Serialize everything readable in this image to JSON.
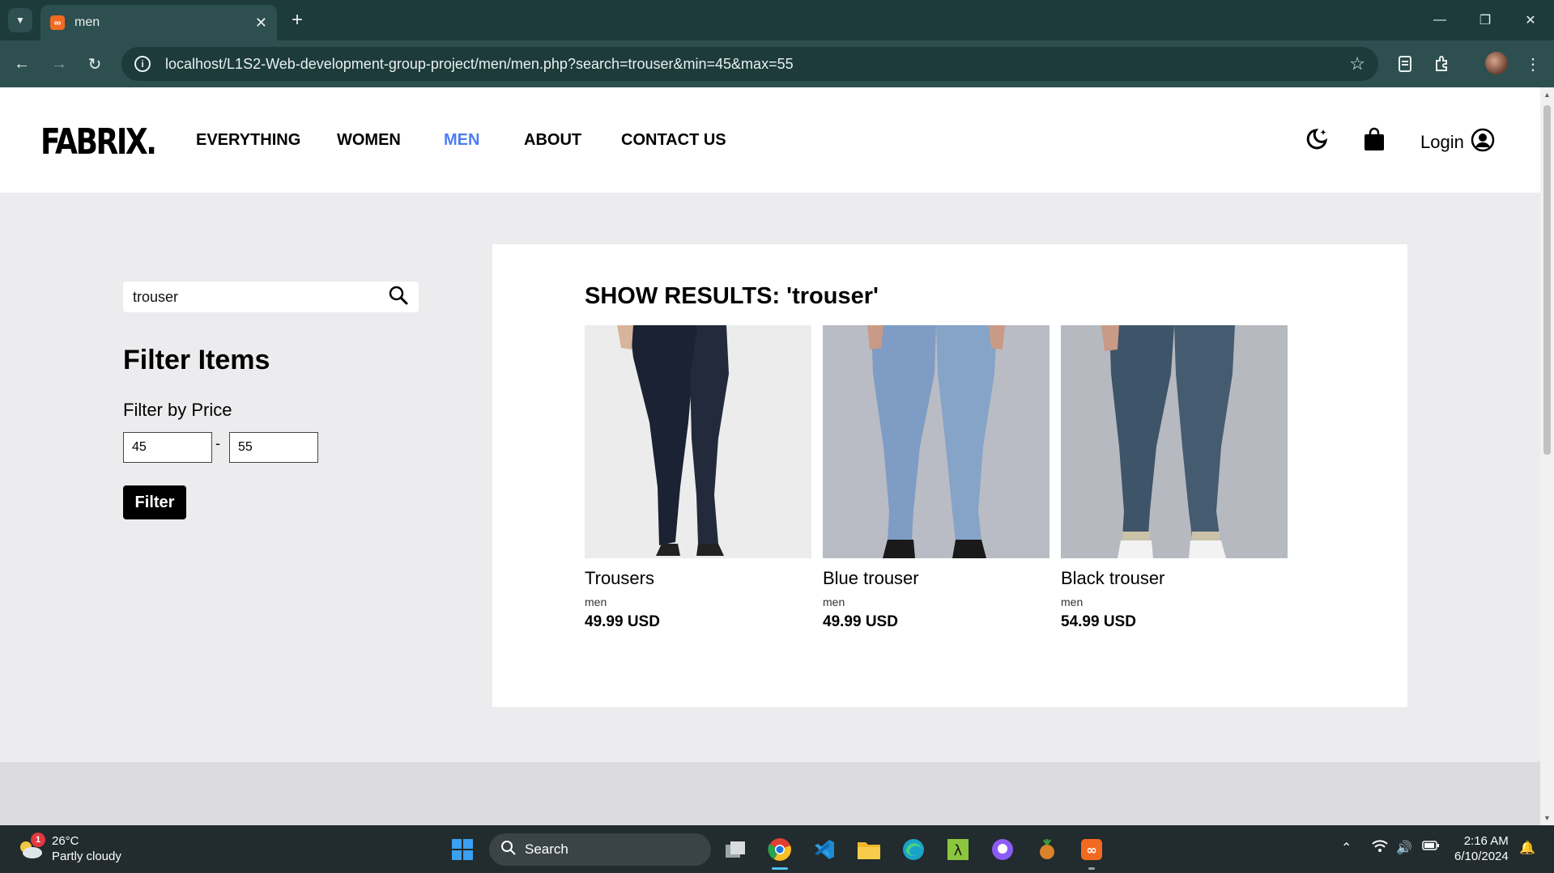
{
  "browser": {
    "tab_title": "men",
    "url": "localhost/L1S2-Web-development-group-project/men/men.php?search=trouser&min=45&max=55"
  },
  "site": {
    "logo": "FABRIX.",
    "nav": [
      "EVERYTHING",
      "WOMEN",
      "MEN",
      "ABOUT",
      "CONTACT US"
    ],
    "active_nav": "MEN",
    "login_label": "Login"
  },
  "sidebar": {
    "search_value": "trouser",
    "filter_title": "Filter Items",
    "filter_by_price_label": "Filter by Price",
    "min_price": "45",
    "max_price": "55",
    "range_separator": "-",
    "filter_button": "Filter"
  },
  "results": {
    "title": "SHOW RESULTS: 'trouser'",
    "products": [
      {
        "name": "Trousers",
        "category": "men",
        "price": "49.99 USD"
      },
      {
        "name": "Blue trouser",
        "category": "men",
        "price": "49.99 USD"
      },
      {
        "name": "Black trouser",
        "category": "men",
        "price": "54.99 USD"
      }
    ]
  },
  "taskbar": {
    "weather_temp": "26°C",
    "weather_desc": "Partly cloudy",
    "weather_badge": "1",
    "search_label": "Search",
    "time": "2:16 AM",
    "date": "6/10/2024"
  },
  "colors": {
    "accent_nav": "#4f7df5",
    "chrome_dark": "#1d3b3b",
    "chrome_toolbar": "#2e4f4f",
    "page_bg": "#ececee"
  }
}
